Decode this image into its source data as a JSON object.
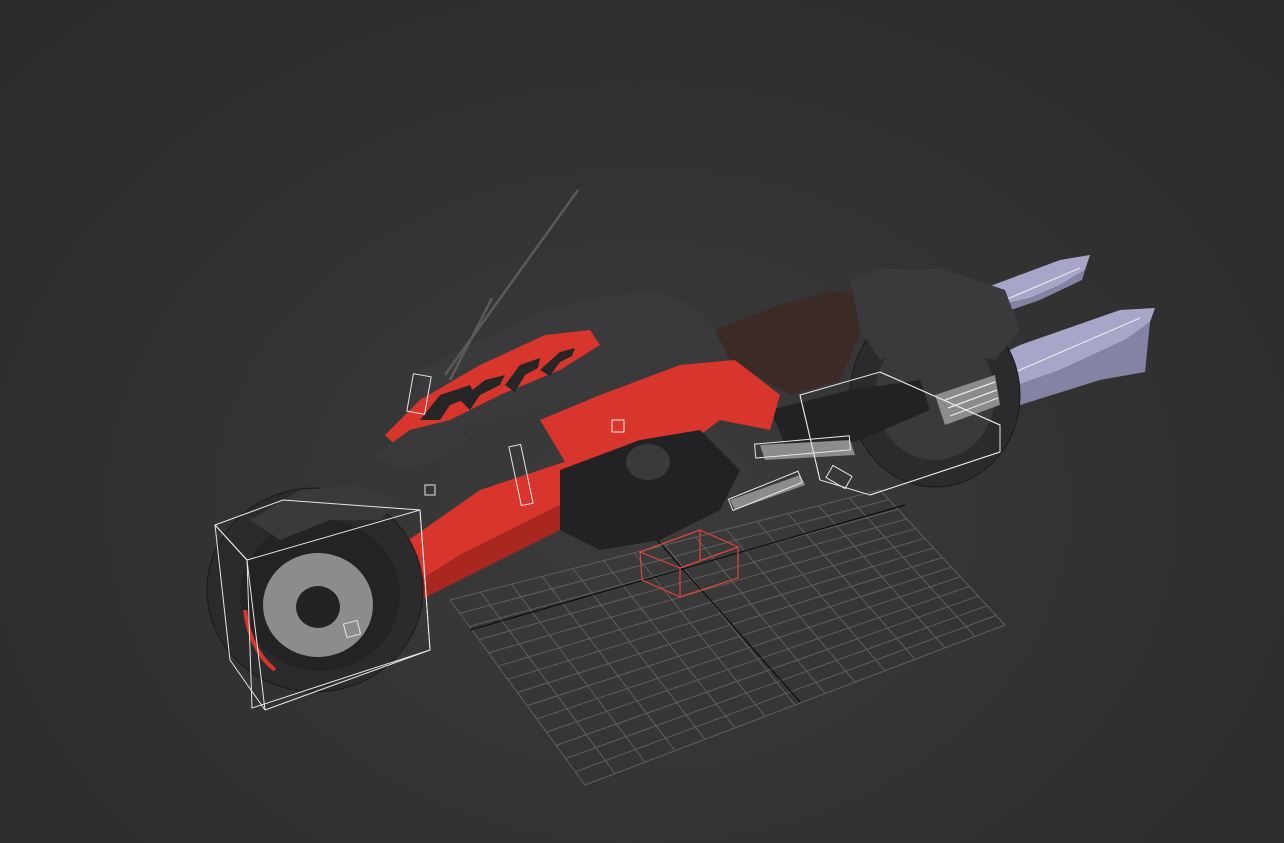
{
  "viewport": {
    "background_color": "#363636",
    "grid_color": "#5e5e5e",
    "axis_color": "#0d0d0d",
    "selection_bracket_color": "#e6e6e6",
    "pivot_box_color": "#e0453c"
  },
  "model": {
    "body_red": "#d8352c",
    "body_dark": "#3a3a3c",
    "body_black": "#222224",
    "seat_color": "#3b2a26",
    "tire_color": "#2b2b2d",
    "blade_color": "#a8a6c8",
    "rim_color": "#8c8c8c",
    "livery_text_color": "#262626"
  },
  "icons": {
    "pivot": "pivot-box-icon",
    "selection": "selection-bracket-icon"
  }
}
